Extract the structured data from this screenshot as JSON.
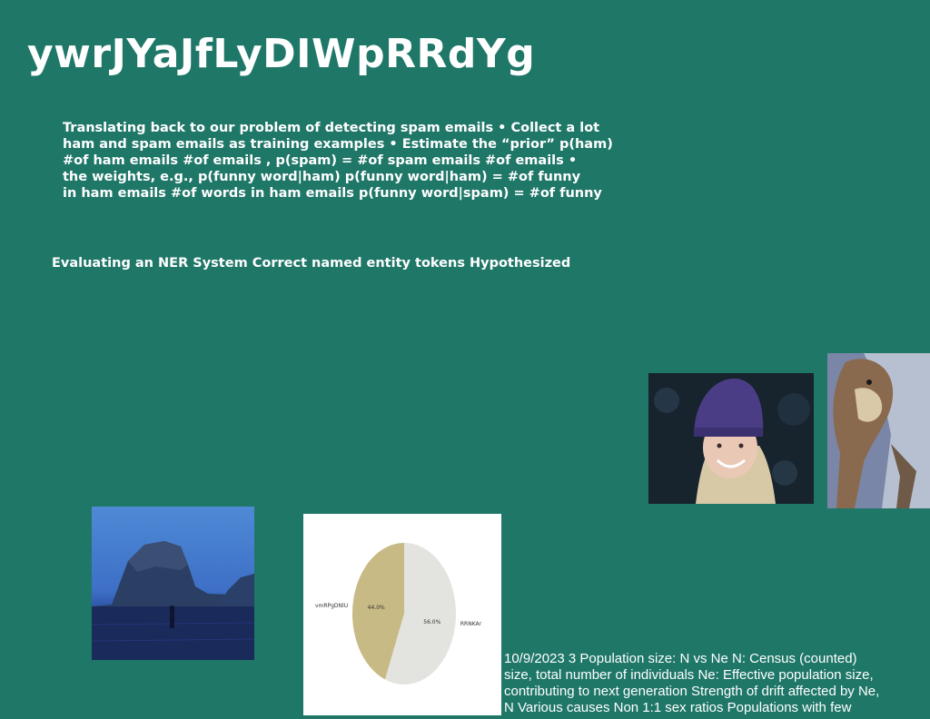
{
  "title": "ywrJYaJfLyDIWpRRdYg",
  "paragraph_lines": [
    "Translating back to our problem of detecting spam emails • Collect a lot",
    "ham and spam emails as training examples • Estimate the “prior” p(ham)",
    "#of ham emails #of emails , p(spam) = #of spam emails #of emails •",
    "the weights, e.g., p(funny word|ham) p(funny word|ham) = #of funny",
    "in ham emails #of words in ham emails p(funny word|spam) = #of funny"
  ],
  "subheading": "Evaluating an NER System Correct named entity tokens Hypothesized",
  "chart_data": {
    "type": "pie",
    "slices": [
      {
        "label": "vmRPgDNlU",
        "value": 44.0,
        "value_label": "44.0%",
        "color": "#c8ba85"
      },
      {
        "label": "RRNKAr",
        "value": 56.0,
        "value_label": "56.0%",
        "color": "#e3e3df"
      }
    ]
  },
  "footer_lines": [
    "10/9/2023 3 Population size: N vs Ne  N: Census (counted)",
    "size, total number of individuals  Ne: Effective population size,",
    "contributing to next generation  Strength of drift affected by Ne,",
    "N  Various causes  Non 1:1 sex ratios  Populations with few"
  ]
}
